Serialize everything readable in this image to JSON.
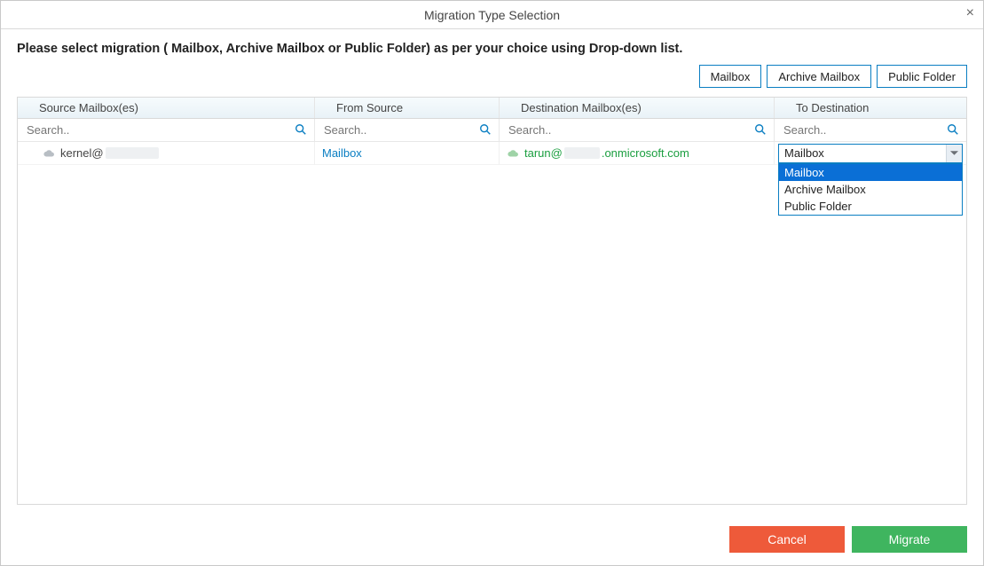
{
  "header": {
    "title": "Migration Type Selection"
  },
  "instruction": "Please select migration ( Mailbox, Archive Mailbox or Public Folder) as per your choice using Drop-down list.",
  "topButtons": {
    "mailbox": "Mailbox",
    "archive": "Archive Mailbox",
    "public": "Public Folder"
  },
  "columns": {
    "source": "Source Mailbox(es)",
    "fromSource": "From Source",
    "destination": "Destination Mailbox(es)",
    "toDestination": "To Destination"
  },
  "search": {
    "placeholder": "Search.."
  },
  "rows": [
    {
      "source_prefix": "kernel@",
      "fromSource": "Mailbox",
      "dest_prefix": "tarun@",
      "dest_suffix": ".onmicrosoft.com",
      "toDestination": "Mailbox"
    }
  ],
  "dropdown": {
    "options": [
      "Mailbox",
      "Archive Mailbox",
      "Public Folder"
    ],
    "selected": "Mailbox"
  },
  "footer": {
    "cancel": "Cancel",
    "migrate": "Migrate"
  }
}
